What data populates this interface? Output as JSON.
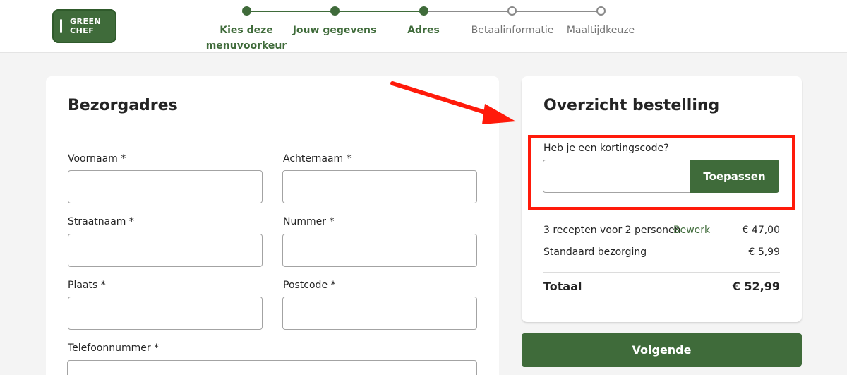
{
  "header": {
    "logo": {
      "line1": "GREEN",
      "line2": "CHEF"
    },
    "steps": [
      {
        "label": "Kies deze\nmenuvoorkeur",
        "label_line1": "Kies deze",
        "label_line2": "menuvoorkeur",
        "state": "done"
      },
      {
        "label": "Jouw gegevens",
        "state": "done"
      },
      {
        "label": "Adres",
        "state": "done"
      },
      {
        "label": "Betaalinformatie",
        "state": "todo"
      },
      {
        "label": "Maaltijdkeuze",
        "state": "todo"
      }
    ]
  },
  "address_form": {
    "title": "Bezorgadres",
    "fields": [
      {
        "label": "Voornaam *",
        "value": ""
      },
      {
        "label": "Achternaam *",
        "value": ""
      },
      {
        "label": "Straatnaam *",
        "value": ""
      },
      {
        "label": "Nummer *",
        "value": ""
      },
      {
        "label": "Plaats *",
        "value": ""
      },
      {
        "label": "Postcode *",
        "value": ""
      },
      {
        "label": "Telefoonnummer *",
        "value": ""
      }
    ]
  },
  "order_summary": {
    "title": "Overzicht bestelling",
    "promo": {
      "label": "Heb je een kortingscode?",
      "value": "",
      "button": "Toepassen"
    },
    "lines": [
      {
        "label": "3 recepten voor 2 personen",
        "link": "Bewerk",
        "price": "€ 47,00"
      },
      {
        "label": "Standaard bezorging",
        "price": "€ 5,99"
      }
    ],
    "total": {
      "label": "Totaal",
      "price": "€ 52,99"
    }
  },
  "next_button": "Volgende",
  "colors": {
    "brand_green": "#3f6b3a",
    "annotation_red": "#ff1a0a",
    "background": "#f4f4f4"
  }
}
